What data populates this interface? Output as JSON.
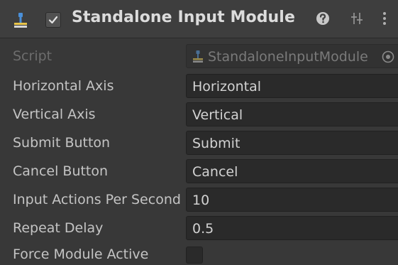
{
  "component": {
    "title": "Standalone Input Module",
    "enabled": true
  },
  "header_icons": [
    "script-component-icon",
    "enable-checkbox",
    "help-icon",
    "presets-icon",
    "menu-icon"
  ],
  "script": {
    "label": "Script",
    "value": "StandaloneInputModule",
    "icon": "script-file-icon"
  },
  "fields": {
    "horizontal_axis": {
      "label": "Horizontal Axis",
      "value": "Horizontal"
    },
    "vertical_axis": {
      "label": "Vertical Axis",
      "value": "Vertical"
    },
    "submit_button": {
      "label": "Submit Button",
      "value": "Submit"
    },
    "cancel_button": {
      "label": "Cancel Button",
      "value": "Cancel"
    },
    "input_actions_per_second": {
      "label": "Input Actions Per Second",
      "value": "10"
    },
    "repeat_delay": {
      "label": "Repeat Delay",
      "value": "0.5"
    },
    "force_module_active": {
      "label": "Force Module Active",
      "checked": false
    }
  },
  "colors": {
    "background": "#383838",
    "header": "#3e3e3e",
    "field": "#2a2a2a",
    "text": "#c4c4c4",
    "icon_blue": "#4a8fd8",
    "icon_yellow": "#e8c44a"
  }
}
